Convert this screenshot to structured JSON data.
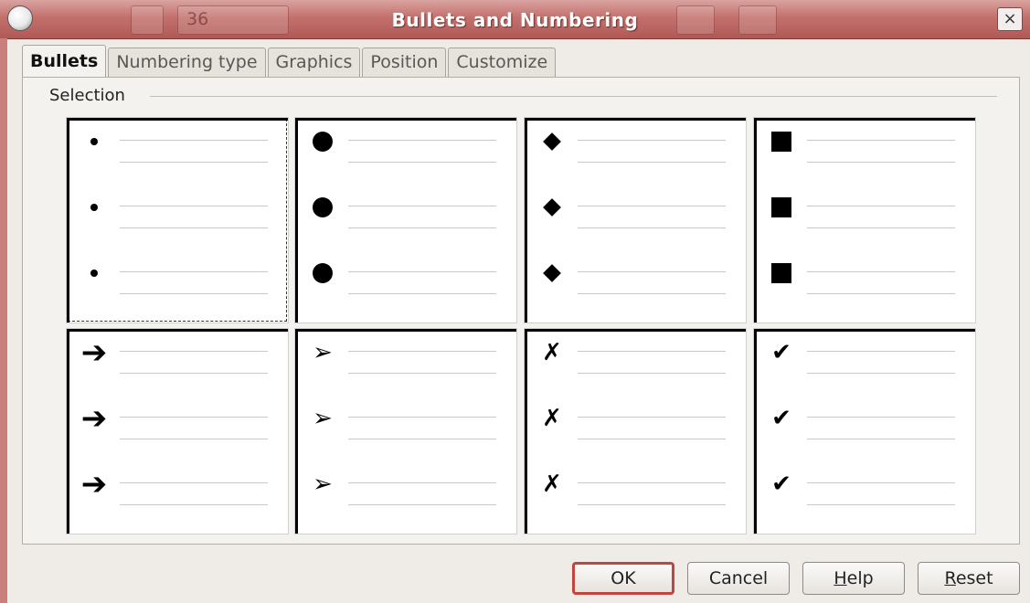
{
  "window": {
    "title": "Bullets and Numbering",
    "close_label": "×",
    "background_toolbar_value": "36"
  },
  "tabs": [
    {
      "label": "Bullets",
      "active": true
    },
    {
      "label": "Numbering type",
      "active": false
    },
    {
      "label": "Graphics",
      "active": false
    },
    {
      "label": "Position",
      "active": false
    },
    {
      "label": "Customize",
      "active": false
    }
  ],
  "section": {
    "label": "Selection"
  },
  "bullet_styles": [
    {
      "name": "small-dot",
      "glyph": ""
    },
    {
      "name": "large-dot",
      "glyph": ""
    },
    {
      "name": "diamond",
      "glyph": ""
    },
    {
      "name": "square",
      "glyph": ""
    },
    {
      "name": "arrow",
      "glyph": "➔"
    },
    {
      "name": "arrowhead",
      "glyph": "➢"
    },
    {
      "name": "cross",
      "glyph": "✗"
    },
    {
      "name": "check",
      "glyph": "✔"
    }
  ],
  "buttons": {
    "ok": "OK",
    "cancel": "Cancel",
    "help_prefix": "H",
    "help_rest": "elp",
    "reset_prefix": "R",
    "reset_rest": "eset"
  },
  "colors": {
    "titlebar": "#c4706c",
    "default_button_border": "#c2463f"
  }
}
